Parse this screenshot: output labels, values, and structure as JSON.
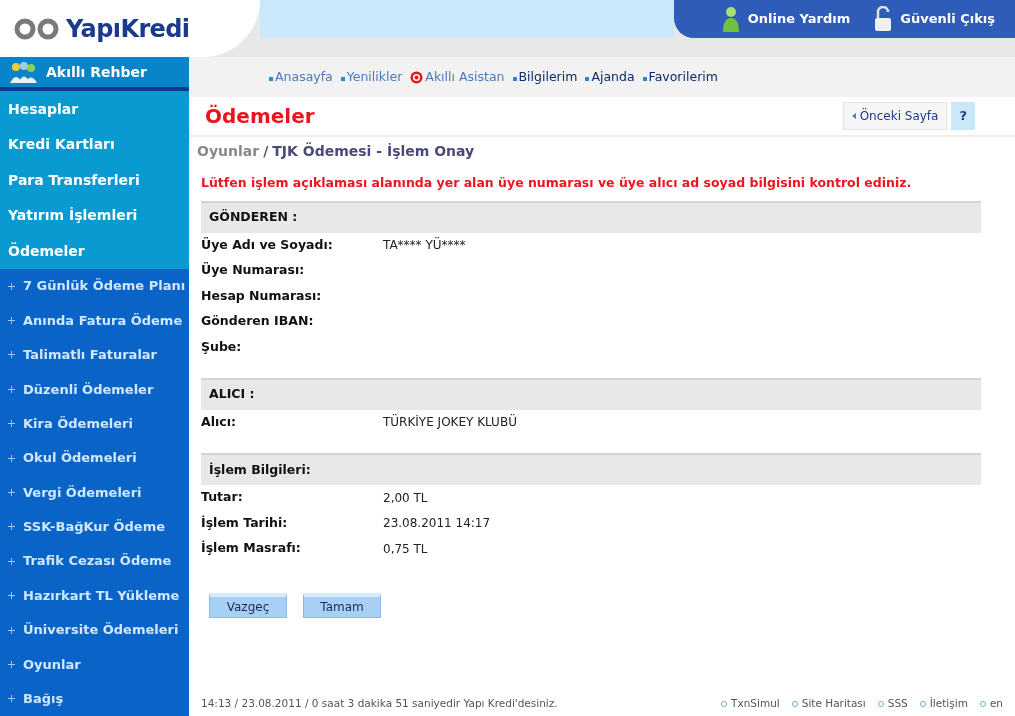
{
  "header": {
    "logo": "YapıKredi",
    "actions": [
      {
        "label": "Online Yardım",
        "kind": "help"
      },
      {
        "label": "Güvenli Çıkış",
        "kind": "logout"
      }
    ]
  },
  "sidebar": {
    "guide": "Akıllı Rehber",
    "items": [
      {
        "label": "Hesaplar",
        "kind": "main"
      },
      {
        "label": "Kredi Kartları",
        "kind": "main"
      },
      {
        "label": "Para Transferleri",
        "kind": "main"
      },
      {
        "label": "Yatırım İşlemleri",
        "kind": "main"
      },
      {
        "label": "Ödemeler",
        "kind": "main"
      },
      {
        "label": "7 Günlük Ödeme Planı",
        "kind": "sub"
      },
      {
        "label": "Anında Fatura Ödeme",
        "kind": "sub"
      },
      {
        "label": "Talimatlı Faturalar",
        "kind": "sub"
      },
      {
        "label": "Düzenli Ödemeler",
        "kind": "sub"
      },
      {
        "label": "Kira Ödemeleri",
        "kind": "sub"
      },
      {
        "label": "Okul Ödemeleri",
        "kind": "sub"
      },
      {
        "label": "Vergi Ödemeleri",
        "kind": "sub"
      },
      {
        "label": "SSK-BağKur Ödeme",
        "kind": "sub"
      },
      {
        "label": "Trafik Cezası Ödeme",
        "kind": "sub"
      },
      {
        "label": "Hazırkart TL Yükleme",
        "kind": "sub"
      },
      {
        "label": "Üniversite Ödemeleri",
        "kind": "sub"
      },
      {
        "label": "Oyunlar",
        "kind": "sub"
      },
      {
        "label": "Bağış",
        "kind": "sub"
      }
    ]
  },
  "top_nav": [
    {
      "label": "Anasayfa",
      "kind": "link",
      "visited": true
    },
    {
      "label": "Yenilikler",
      "kind": "link",
      "visited": true
    },
    {
      "label": "Akıllı Asistan",
      "kind": "assistant",
      "visited": true
    },
    {
      "label": "Bilgilerim",
      "kind": "link",
      "visited": false
    },
    {
      "label": "Ajanda",
      "kind": "link",
      "visited": false
    },
    {
      "label": "Favorilerim",
      "kind": "link",
      "visited": false
    }
  ],
  "page": {
    "title": "Ödemeler",
    "back_button": "Önceki Sayfa",
    "help_button": "?",
    "breadcrumb": {
      "parent": "Oyunlar",
      "separator": "/",
      "current": "TJK Ödemesi - İşlem Onay"
    },
    "warning": "Lütfen işlem açıklaması alanında yer alan üye numarası ve üye alıcı ad soyad bilgisini kontrol ediniz.",
    "sections": [
      {
        "title": "GÖNDEREN :",
        "rows": [
          {
            "label": "Üye Adı ve Soyadı:",
            "value": "TA**** YÜ****"
          },
          {
            "label": "Üye Numarası:"
          },
          {
            "label": "Hesap Numarası:"
          },
          {
            "label": "Gönderen IBAN:"
          },
          {
            "label": "Şube:"
          }
        ]
      },
      {
        "title": "ALICI :",
        "rows": [
          {
            "label": "Alıcı:",
            "value": "TÜRKİYE JOKEY KLUBÜ"
          }
        ]
      },
      {
        "title": "İşlem Bilgileri:",
        "rows": [
          {
            "label": "Tutar:",
            "value": "2,00 TL"
          },
          {
            "label": "İşlem Tarihi:",
            "value": "23.08.2011 14:17"
          },
          {
            "label": "İşlem Masrafı:",
            "value": "0,75 TL"
          }
        ]
      }
    ],
    "buttons": [
      "Vazgeç",
      "Tamam"
    ]
  },
  "footer": {
    "status": "14:13 / 23.08.2011 / 0 saat 3 dakika 51 saniyedir Yapı Kredi'desiniz.",
    "links": [
      "TxnSimul",
      "Site Haritası",
      "SSS",
      "İletişim",
      "en"
    ]
  }
}
